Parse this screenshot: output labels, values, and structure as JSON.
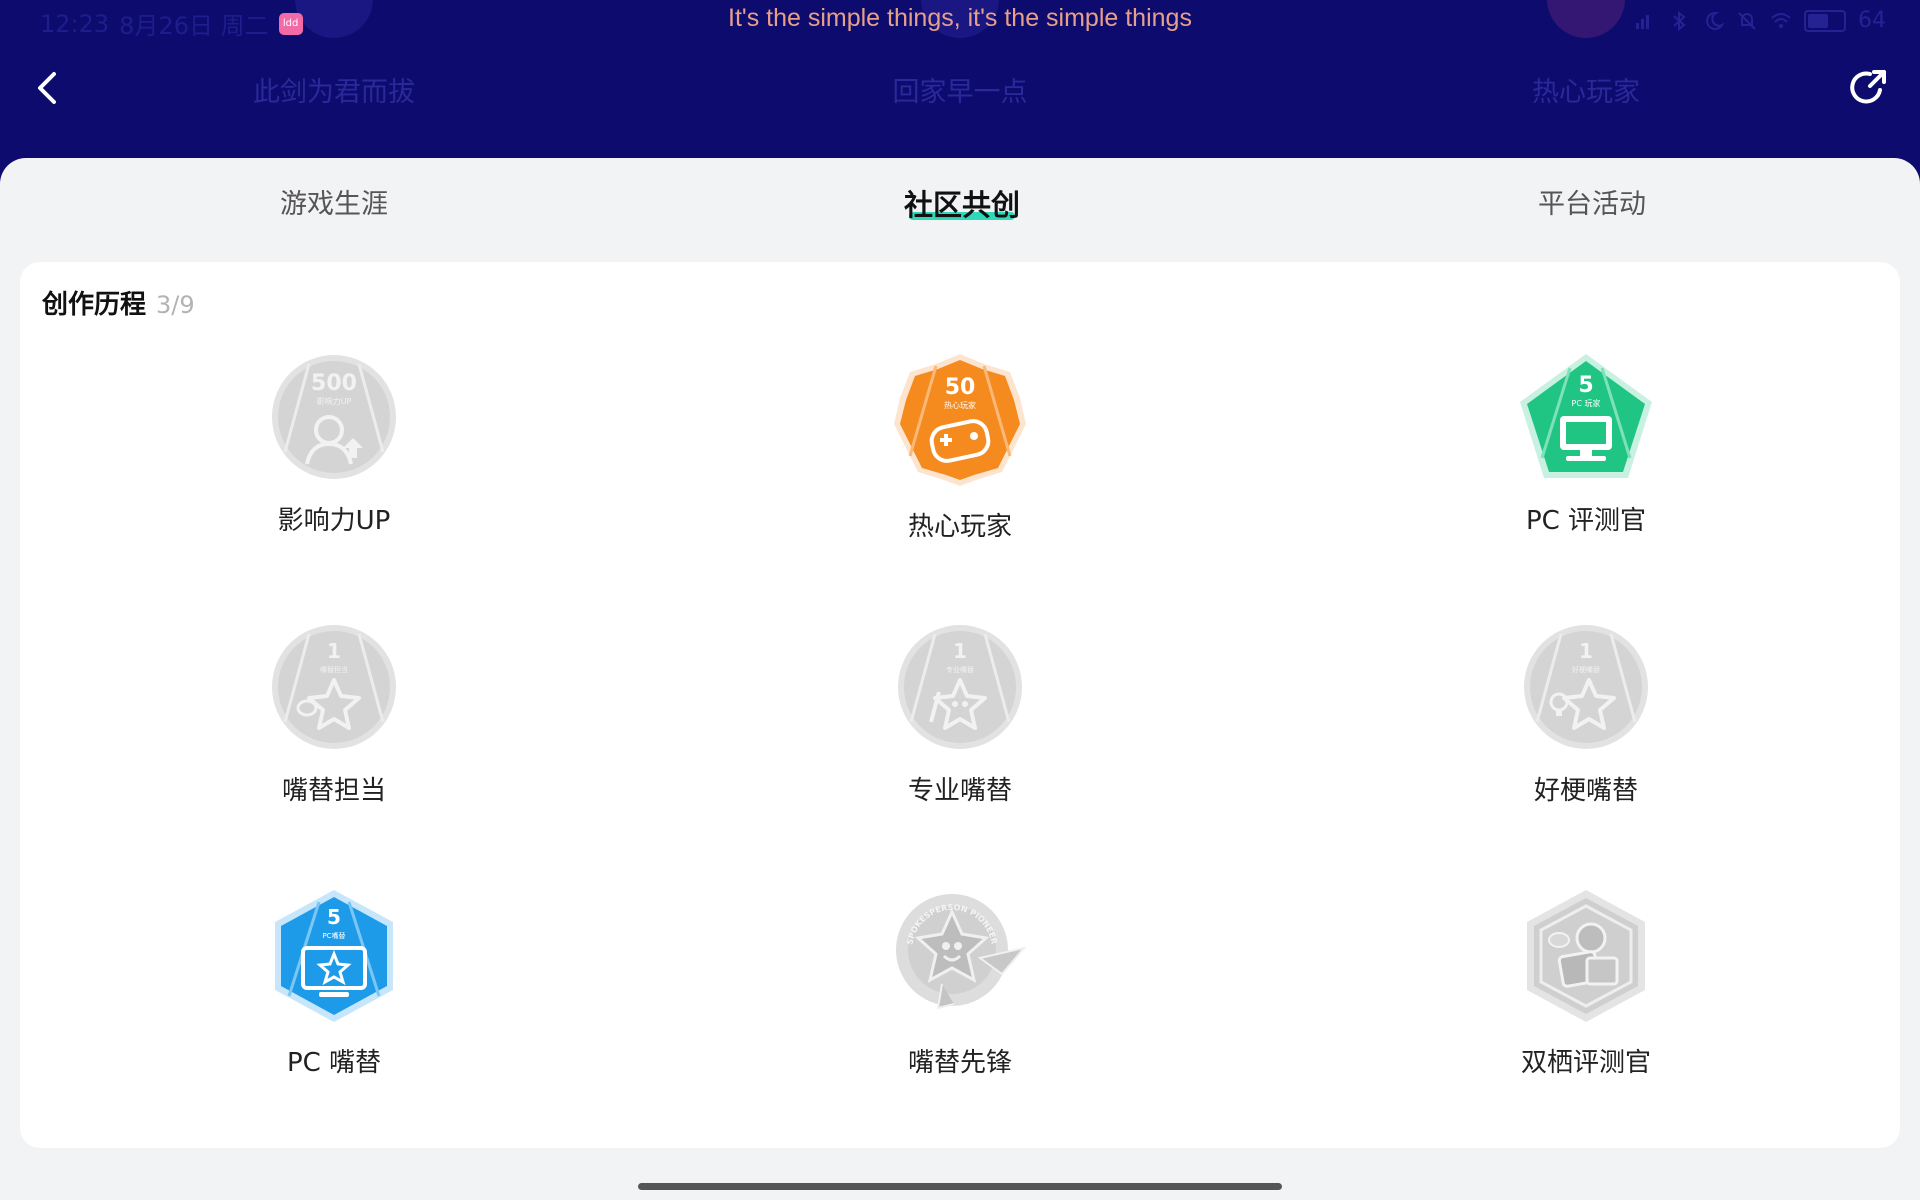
{
  "status_bar": {
    "time": "12:23",
    "date": "8月26日 周二",
    "app_icon_text": "ldd",
    "battery": "64"
  },
  "lyric": "It's the simple things, it's the simple things",
  "header": {
    "ghost_labels": [
      "此剑为君而拔",
      "回家早一点",
      "热心玩家"
    ],
    "back_icon": "chevron-left-icon",
    "share_icon": "share-icon"
  },
  "tabs": [
    {
      "label": "游戏生涯",
      "active": false
    },
    {
      "label": "社区共创",
      "active": true
    },
    {
      "label": "平台活动",
      "active": false
    }
  ],
  "section": {
    "title": "创作历程",
    "count": "3/9"
  },
  "badges": [
    {
      "name": "影响力UP",
      "number": "500",
      "sub": "影响力UP",
      "unlocked": false,
      "color": "#d4d4d4"
    },
    {
      "name": "热心玩家",
      "number": "50",
      "sub": "热心玩家",
      "unlocked": true,
      "color": "#f58a1f"
    },
    {
      "name": "PC 评测官",
      "number": "5",
      "sub": "PC 玩家",
      "unlocked": true,
      "color": "#20c584"
    },
    {
      "name": "嘴替担当",
      "number": "1",
      "sub": "嘴替担当",
      "unlocked": false,
      "color": "#d4d4d4"
    },
    {
      "name": "专业嘴替",
      "number": "1",
      "sub": "专业嘴替",
      "unlocked": false,
      "color": "#d4d4d4"
    },
    {
      "name": "好梗嘴替",
      "number": "1",
      "sub": "好梗嘴替",
      "unlocked": false,
      "color": "#d4d4d4"
    },
    {
      "name": "PC 嘴替",
      "number": "5",
      "sub": "PC嘴替",
      "unlocked": true,
      "color": "#1e9be8"
    },
    {
      "name": "嘴替先锋",
      "number": "",
      "sub": "SPOKESPERSON PIONEER",
      "unlocked": false,
      "color": "#d4d4d4"
    },
    {
      "name": "双栖评测官",
      "number": "",
      "sub": "",
      "unlocked": false,
      "color": "#d4d4d4"
    }
  ]
}
